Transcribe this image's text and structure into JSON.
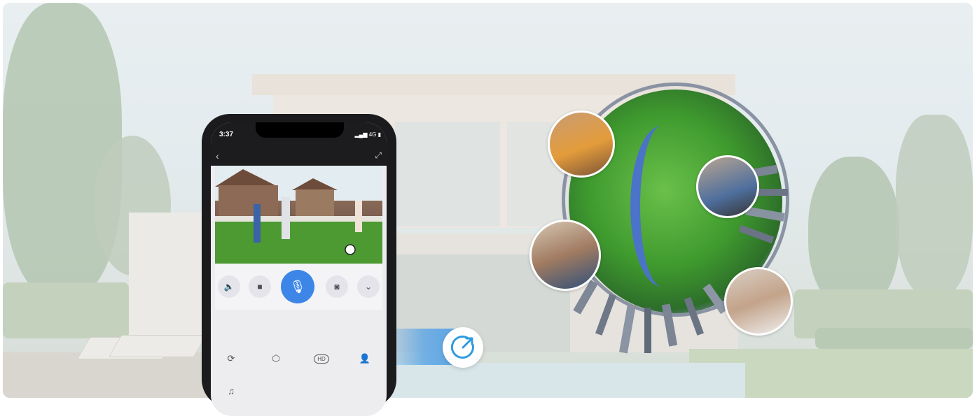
{
  "phone": {
    "status_time": "3:37",
    "status_network": "4G",
    "controls": [
      "mute-icon",
      "record-icon",
      "mic-icon",
      "snapshot-icon",
      "chevron-down-icon"
    ],
    "tools": [
      "playback-icon",
      "settings-icon",
      "hd-icon",
      "add-user-icon",
      "music-icon"
    ],
    "hd_label": "HD"
  },
  "colors": {
    "accent": "#3d86e8",
    "share_icon": "#2f9be0"
  },
  "icons": {
    "share": "share-icon"
  }
}
